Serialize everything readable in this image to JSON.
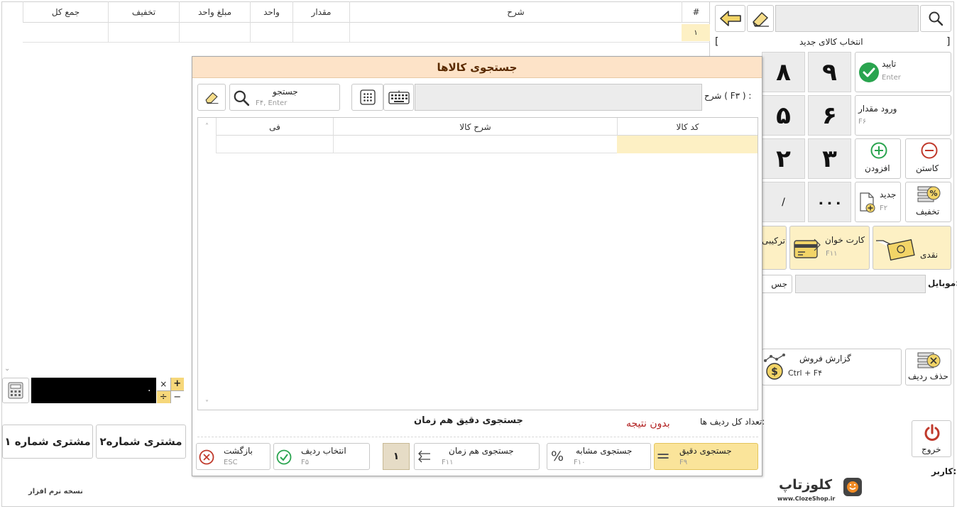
{
  "main_table": {
    "headers": [
      "#",
      "شرح",
      "مقدار",
      "واحد",
      "مبلغ واحد",
      "تخفیف",
      "جمع کل"
    ],
    "row_number": "۱"
  },
  "calc": {
    "display": "۰"
  },
  "customers": {
    "c1": "مشتری شماره ۱",
    "c2": "مشتری شماره۲"
  },
  "version_label": "نسخه نرم افزار",
  "right_panel": {
    "new_item_label": "انتخاب کالای جدید",
    "confirm": {
      "label": "تایید",
      "hint": "Enter"
    },
    "qty": {
      "label": "ورود مقدار",
      "hint": "F۶"
    },
    "keys": [
      "۹",
      "۸",
      "۶",
      "۵",
      "۳",
      "۲",
      "۰۰۰",
      "/"
    ],
    "add_label": "افزودن",
    "sub_label": "کاستن",
    "new": {
      "label": "جدید",
      "hint": "F۲"
    },
    "discount_label": "تخفیف",
    "cash_label": "نقدی",
    "card": {
      "label": "کارت خوان",
      "hint": "F۱۱"
    },
    "combo_label": "ترکیبی",
    "mobile_label": "موبایل:",
    "search_small": "جس",
    "sales_report": {
      "label": "گزارش فروش",
      "hint": "Ctrl + F۴"
    },
    "delete_row_label": "حذف ردیف",
    "exit_label": "خروج",
    "user_label": "کاربر:",
    "brand": {
      "name": "کلوزتاپ",
      "url": "www.ClozeShop.ir"
    }
  },
  "dialog": {
    "title": "جستجوی کالاها",
    "desc_label": "شرح ( F۳ ) :",
    "search_btn": {
      "label": "جستجو",
      "hint": "F۴, Enter"
    },
    "columns": [
      "کد کالا",
      "شرح کالا",
      "فی"
    ],
    "total_rows_label": "تعداد کل ردیف ها:",
    "no_result": "بدون نتیجه",
    "mode_label": "جستجوی دقیق هم زمان",
    "buttons": {
      "exact": {
        "label": "جستجوی دقیق",
        "hint": "F۹"
      },
      "similar": {
        "label": "جستجوی مشابه",
        "hint": "F۱۰"
      },
      "simultaneous": {
        "label": "جستجوی هم زمان",
        "hint": "F۱۱"
      },
      "counter": "۱",
      "select_row": {
        "label": "انتخاب ردیف",
        "hint": "F۵"
      },
      "back": {
        "label": "بازگشت",
        "hint": "ESC"
      }
    }
  },
  "colors": {
    "dialog_header": "#fde3c8",
    "exact_btn": "#fae49a",
    "row_highlight": "#fdf0c4",
    "no_result": "#b22222",
    "confirm_green": "#2aa44f"
  }
}
